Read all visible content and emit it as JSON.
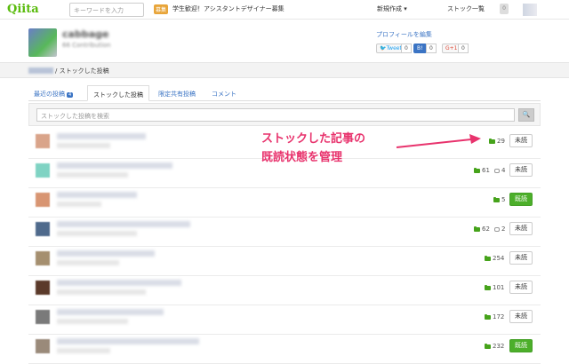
{
  "header": {
    "logo": "Qiita",
    "search_placeholder": "キーワードを入力",
    "promo_badge": "募集",
    "promo_text": "学生歓迎！アシスタントデザイナー募集",
    "nav_new": "新規作成 ▾",
    "nav_stock": "ストック一覧",
    "notification_count": "0"
  },
  "profile": {
    "username": "cabbage",
    "contribution": "66 Contribution",
    "edit_link": "プロフィールを編集",
    "tweet_label": "Tweet",
    "tweet_count": "0",
    "b_count": "0",
    "gplus_label": "G+1",
    "gplus_count": "0"
  },
  "breadcrumb": {
    "current": "/ ストックした投稿"
  },
  "tabs": [
    {
      "label": "最近の投稿",
      "count": "4"
    },
    {
      "label": "ストックした投稿"
    },
    {
      "label": "限定共有投稿"
    },
    {
      "label": "コメント"
    }
  ],
  "stock_search": {
    "placeholder": "ストックした投稿を検索",
    "button_icon": "search-icon"
  },
  "rows": [
    {
      "stocks": "29",
      "comments": "",
      "state": "未読",
      "avatar_color": "#d9a48a"
    },
    {
      "stocks": "61",
      "comments": "4",
      "state": "未読",
      "avatar_color": "#7fd3c3"
    },
    {
      "stocks": "5",
      "comments": "",
      "state": "既読",
      "avatar_color": "#d89572"
    },
    {
      "stocks": "62",
      "comments": "2",
      "state": "未読",
      "avatar_color": "#4f6a8c"
    },
    {
      "stocks": "254",
      "comments": "",
      "state": "未読",
      "avatar_color": "#a58f6f"
    },
    {
      "stocks": "101",
      "comments": "",
      "state": "未読",
      "avatar_color": "#5b3a2a"
    },
    {
      "stocks": "172",
      "comments": "",
      "state": "未読",
      "avatar_color": "#7a7a7a"
    },
    {
      "stocks": "232",
      "comments": "",
      "state": "既読",
      "avatar_color": "#9a8a7a"
    }
  ],
  "annotation": {
    "line1": "ストックした記事の",
    "line2": "既読状態を管理",
    "color": "#e8336d"
  },
  "colors": {
    "accent": "#59bb0c",
    "read_button": "#4caf2a",
    "link": "#3b74c4"
  }
}
